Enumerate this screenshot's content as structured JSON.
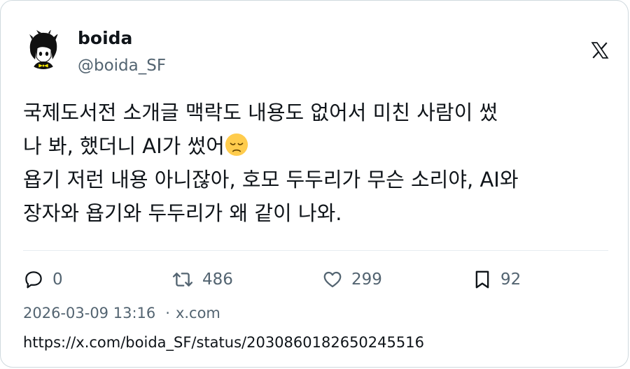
{
  "author": {
    "display_name": "boida",
    "handle": "@boida_SF"
  },
  "icons": {
    "platform_logo": "x-logo-icon",
    "reply": "reply-icon",
    "repost": "repost-icon",
    "like": "heart-icon",
    "bookmark": "bookmark-icon",
    "emoji": "disappointed-face-emoji"
  },
  "tweet": {
    "lines": [
      "국제도서전 소개글 맥락도 내용도 없어서 미친 사람이 썼",
      "나 봐, 했더니 AI가 썼어",
      "욥기 저런 내용 아니잖아, 호모 두두리가 무슨 소리야, AI와",
      "장자와 욥기와 두두리가 왜 같이 나와."
    ]
  },
  "stats": {
    "replies": "0",
    "reposts": "486",
    "likes": "299",
    "bookmarks": "92"
  },
  "meta": {
    "timestamp": "2026-03-09 13:16",
    "separator": "·",
    "source": "x.com"
  },
  "url": "https://x.com/boida_SF/status/2030860182650245516",
  "colors": {
    "text": "#0f1419",
    "secondary": "#536471",
    "border": "#cfd9de",
    "emoji": "#ffcc4d"
  }
}
